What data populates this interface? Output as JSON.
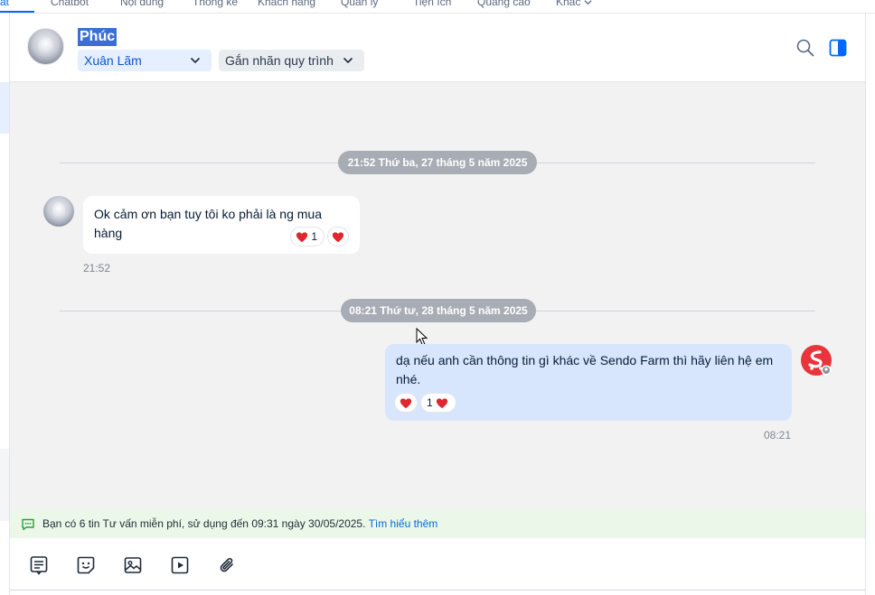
{
  "topnav": {
    "tabs": [
      {
        "label": "at",
        "active": true
      },
      {
        "label": "Chatbot"
      },
      {
        "label": "Nội dung"
      },
      {
        "label": "Thống kê"
      },
      {
        "label": "Khách hàng"
      },
      {
        "label": "Quản lý"
      },
      {
        "label": "Tiện ích"
      },
      {
        "label": "Quảng cáo"
      },
      {
        "label": "Khác"
      }
    ]
  },
  "header": {
    "contact_name": "Phúc",
    "assignee": "Xuân Lãm",
    "label_dropdown": "Gắn nhãn quy trình",
    "icons": [
      "search-icon",
      "panel-toggle-icon"
    ]
  },
  "conversation": {
    "date_1": "21:52 Thứ ba, 27 tháng 5 năm 2025",
    "message_in": {
      "text": "Ok cảm ơn bạn tuy tôi ko phải là ng mua hàng",
      "reaction_count": "1",
      "time": "21:52"
    },
    "date_2": "08:21 Thứ tư, 28 tháng 5 năm 2025",
    "message_out": {
      "text": "dạ nếu anh cần thông tin gì khác về Sendo Farm thì hãy liên hệ em nhé.",
      "reaction_count": "1",
      "time": "08:21"
    }
  },
  "promo": {
    "text": "Bạn có 6 tin Tư vấn miễn phí, sử dụng đến 09:31 ngày 30/05/2025.",
    "link": "Tìm hiểu thêm"
  },
  "composer": {
    "tools": [
      "quick-message-icon",
      "sticker-icon",
      "image-icon",
      "video-icon",
      "attachment-icon"
    ]
  },
  "colors": {
    "accent": "#0068ff",
    "bubble_out": "#d7e6fd",
    "promo_bg": "#ebf8e9",
    "brand_avatar": "#e8343a"
  }
}
